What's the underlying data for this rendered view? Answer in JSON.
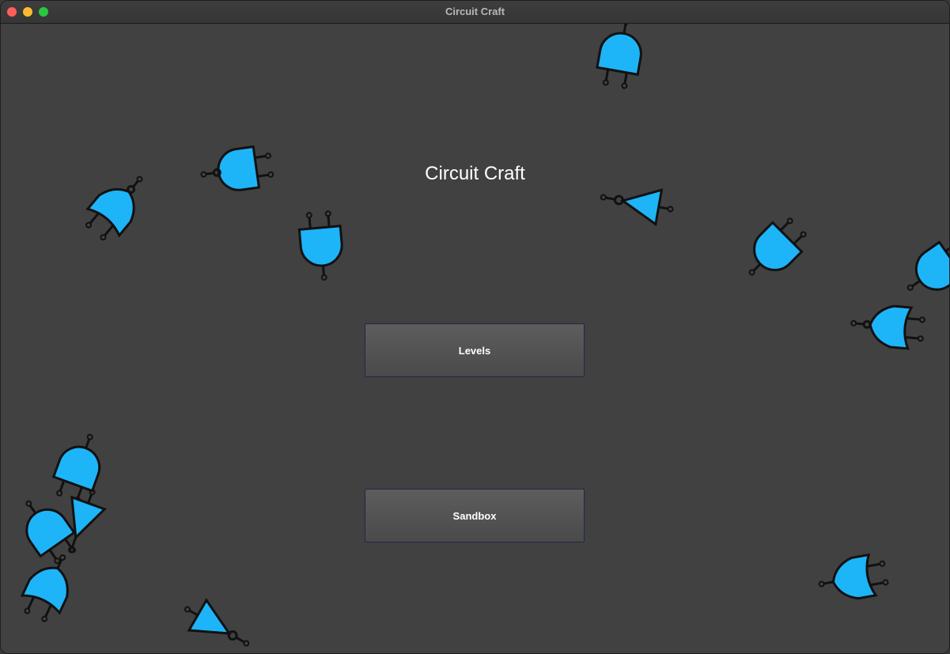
{
  "window": {
    "title": "Circuit Craft",
    "controls": [
      "close",
      "minimize",
      "maximize"
    ]
  },
  "main": {
    "heading": "Circuit Craft",
    "buttons": [
      {
        "label": "Levels"
      },
      {
        "label": "Sandbox"
      }
    ]
  },
  "background_gates": [
    {
      "type": "and-gate"
    },
    {
      "type": "nand-gate"
    },
    {
      "type": "nor-gate"
    },
    {
      "type": "and-gate"
    },
    {
      "type": "not-gate"
    },
    {
      "type": "and-gate"
    },
    {
      "type": "and-gate"
    },
    {
      "type": "nor-gate"
    },
    {
      "type": "and-gate"
    },
    {
      "type": "and-gate"
    },
    {
      "type": "buffer-gate"
    },
    {
      "type": "or-gate"
    },
    {
      "type": "not-gate"
    },
    {
      "type": "or-gate"
    }
  ],
  "colors": {
    "gate_fill": "#1eb4f8",
    "gate_stroke": "#111111",
    "background": "#414141",
    "button_border": "#1c2a45",
    "text": "#ffffff"
  }
}
